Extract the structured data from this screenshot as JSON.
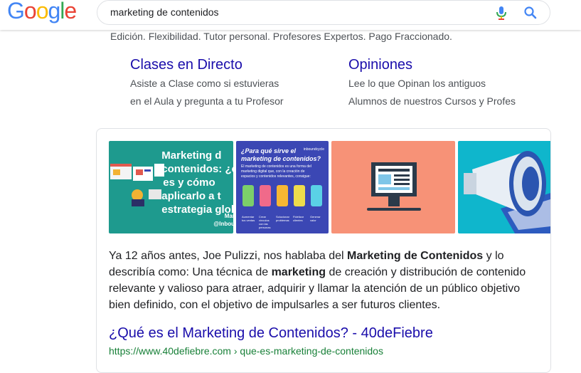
{
  "header": {
    "logo_letters": [
      "G",
      "o",
      "o",
      "g",
      "l",
      "e"
    ],
    "logo_colors": [
      "#4285f4",
      "#ea4335",
      "#fbbc05",
      "#4285f4",
      "#34a853",
      "#ea4335"
    ],
    "search_value": "marketing de contenidos",
    "mic_icon": "mic-icon",
    "search_icon": "magnifier-icon"
  },
  "ad_snippet": "Edición. Flexibilidad. Tutor personal. Profesores Expertos. Pago Fraccionado.",
  "sitelinks": [
    {
      "title": "Clases en Directo",
      "line1": "Asiste a Clase como si estuvieras",
      "line2": "en el Aula y pregunta a tu Profesor"
    },
    {
      "title": "Opiniones",
      "line1": "Lee lo que Opinan los antiguos",
      "line2": "Alumnos de nuestros Cursos y Profes"
    }
  ],
  "featured": {
    "thumb1": {
      "lines": [
        "Marketing d",
        "contenidos: ¿c",
        "es y cómo",
        "aplicarlo a t",
        "estrategia glob"
      ],
      "small1": "Mar",
      "small2": "@Inbou"
    },
    "thumb2": {
      "brand": "inboundcycle",
      "title1": "¿Para qué sirve el",
      "title2": "marketing de contenidos?",
      "sub": "El marketing de contenidos es una forma del marketing digital que, con la creación de espacios y contenidos relevantes, consigue:",
      "captions": [
        "Aumentar tus ventas",
        "Crear vínculos con las personas",
        "Solucionar problemas",
        "Fidelizar clientes",
        "Generar valor"
      ]
    },
    "description": {
      "p1": "Ya 12 años antes, Joe Pulizzi, nos hablaba del ",
      "b1": "Marketing de Contenidos",
      "p2": " y lo describía como: Una técnica de ",
      "b2": "marketing",
      "p3": " de creación y distribución de contenido relevante y valioso para atraer, adquirir y llamar la atención de un público objetivo bien definido, con el objetivo de impulsarles a ser futuros clientes."
    },
    "result_title": "¿Qué es el Marketing de Contenidos? - 40deFiebre",
    "result_url": "https://www.40defiebre.com › que-es-marketing-de-contenidos"
  }
}
